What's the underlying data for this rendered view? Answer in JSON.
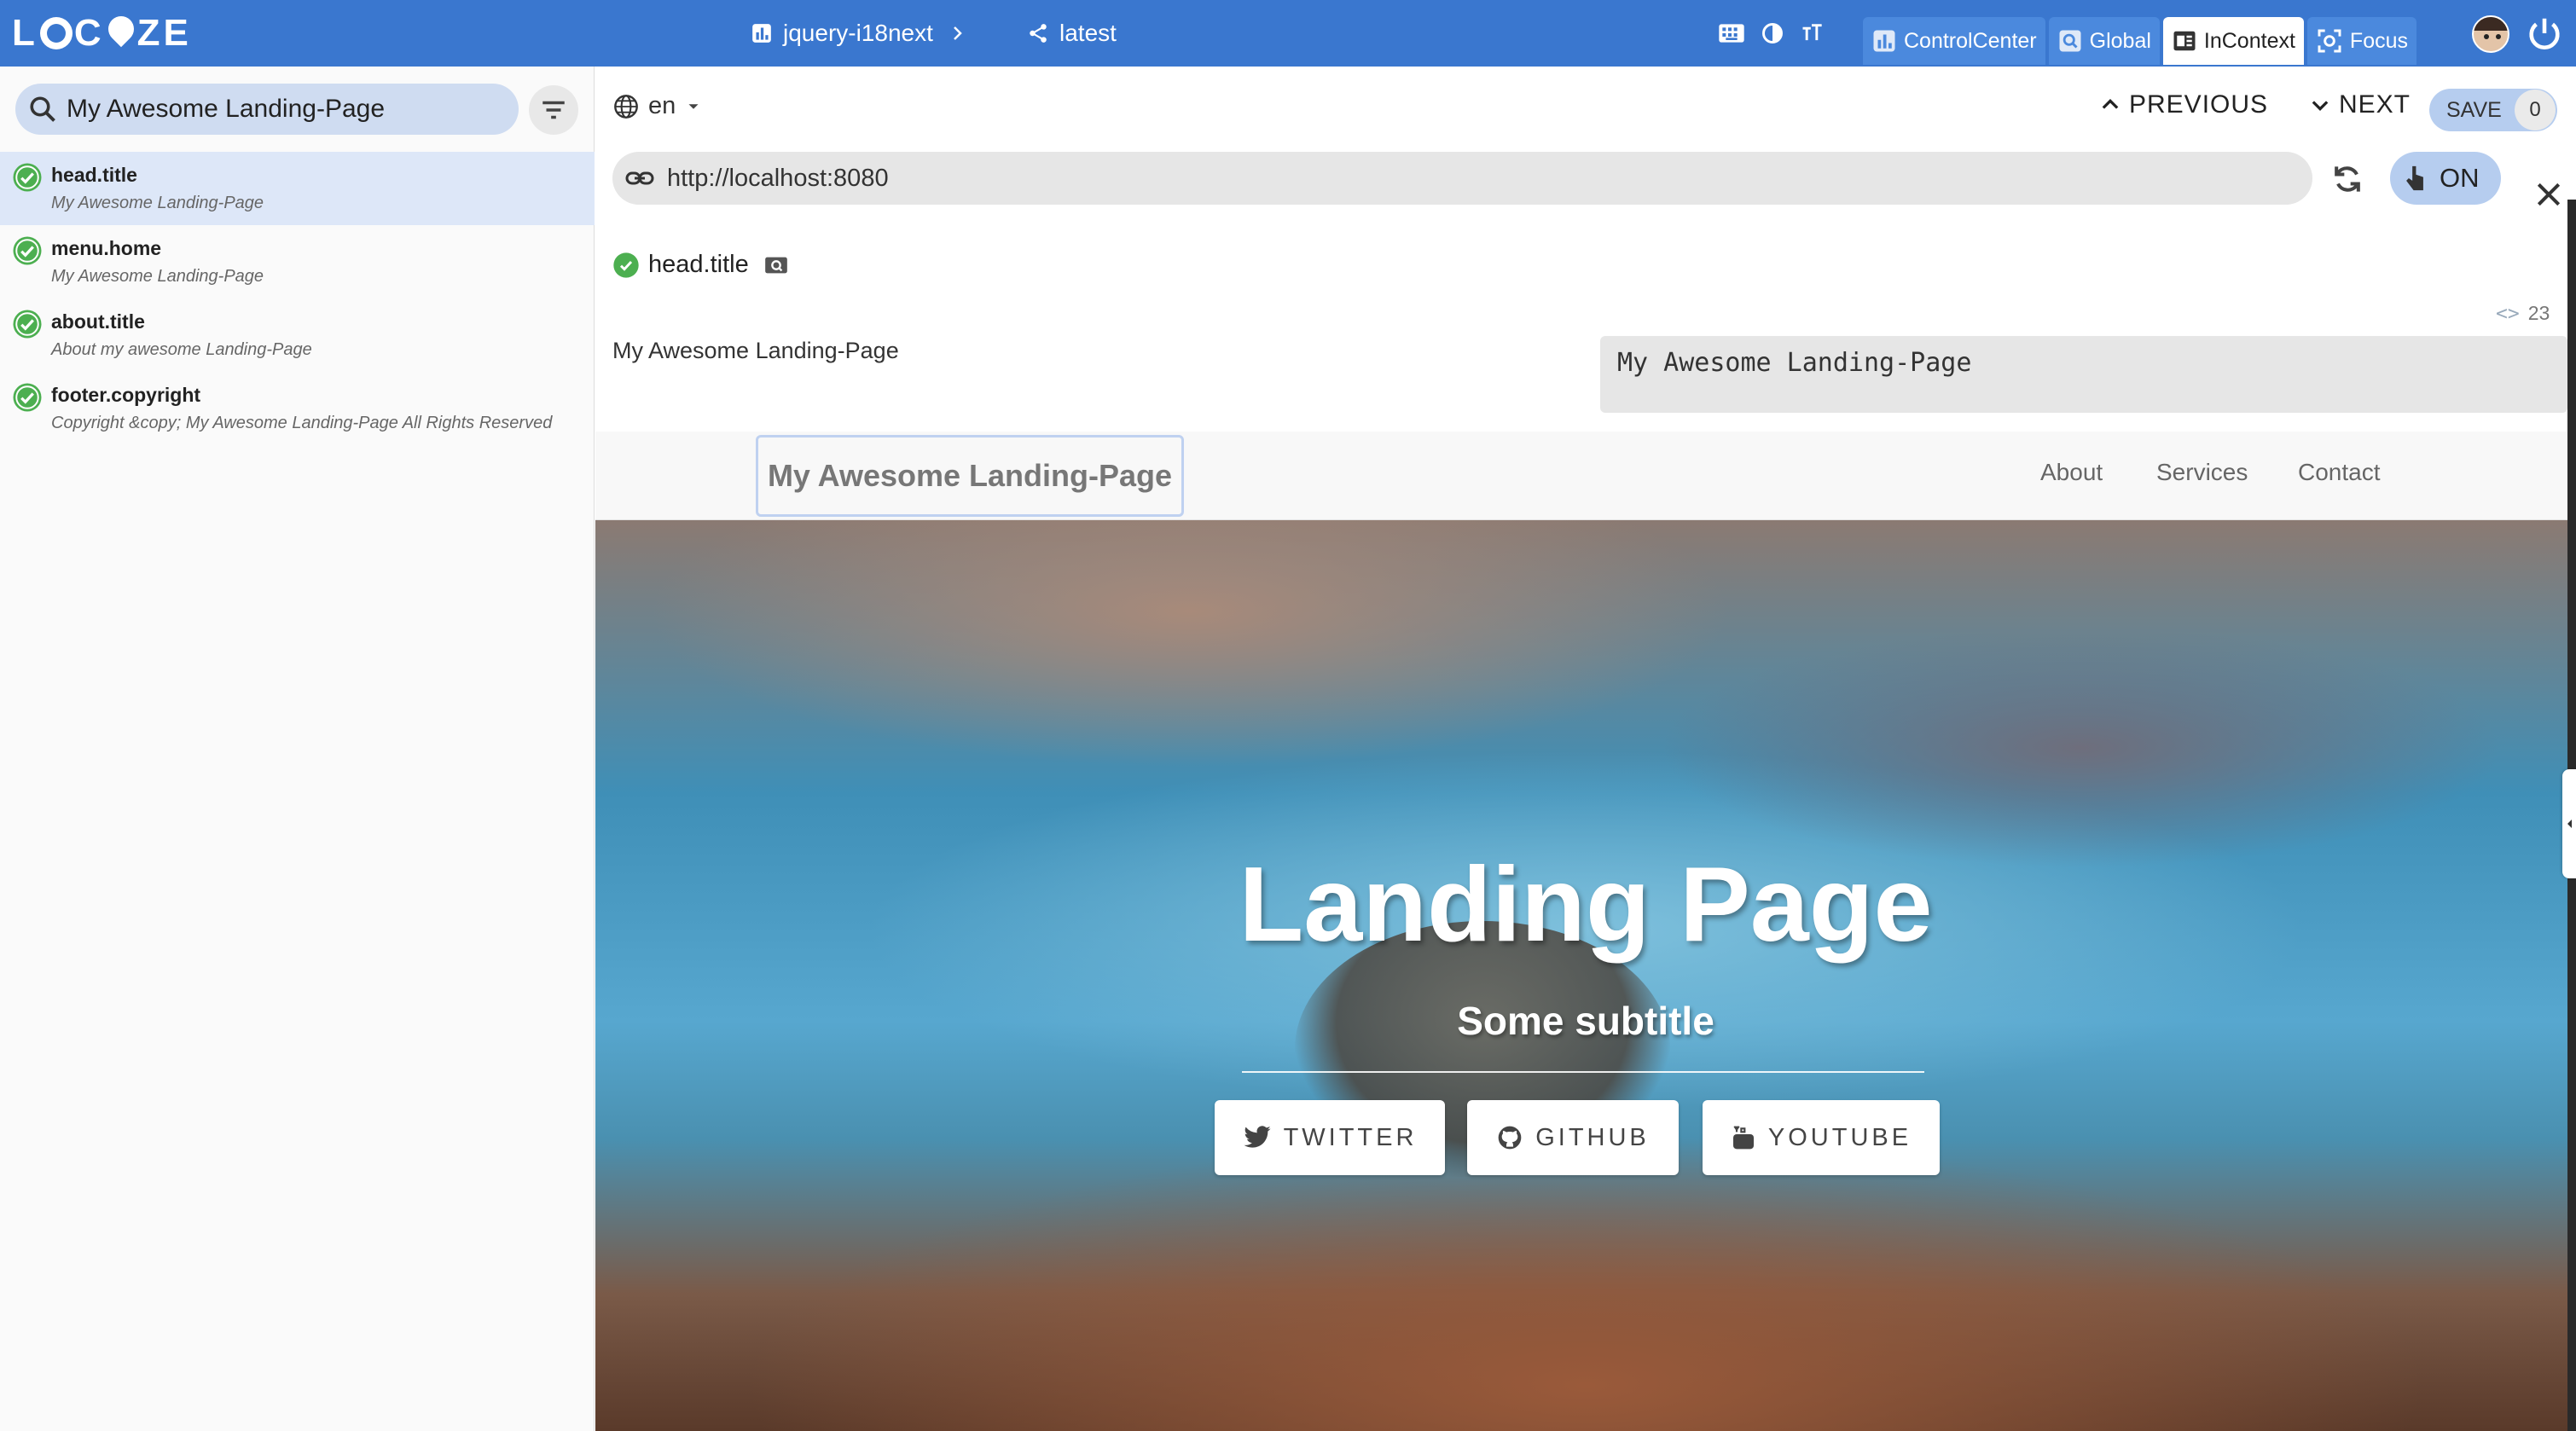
{
  "brand": {
    "logo_text_left": "L",
    "logo_text_right": "ZE"
  },
  "topbar": {
    "project": "jquery-i18next",
    "version": "latest",
    "modes": [
      {
        "label": "ControlCenter",
        "active": false
      },
      {
        "label": "Global",
        "active": false
      },
      {
        "label": "InContext",
        "active": true
      },
      {
        "label": "Focus",
        "active": false
      }
    ]
  },
  "sidebar": {
    "search_value": "My Awesome Landing-Page",
    "items": [
      {
        "key": "head.title",
        "value": "My Awesome Landing-Page",
        "selected": true
      },
      {
        "key": "menu.home",
        "value": "My Awesome Landing-Page",
        "selected": false
      },
      {
        "key": "about.title",
        "value": "About my awesome Landing-Page",
        "selected": false
      },
      {
        "key": "footer.copyright",
        "value": "Copyright &copy; My Awesome Landing-Page All Rights Reserved",
        "selected": false
      }
    ]
  },
  "toolbar": {
    "language": "en",
    "previous_label": "PREVIOUS",
    "next_label": "NEXT",
    "save_label": "SAVE",
    "save_count": "0",
    "url": "http://localhost:8080",
    "toggle_label": "ON"
  },
  "editor": {
    "key": "head.title",
    "char_count": "23",
    "source_text": "My Awesome Landing-Page",
    "translation": "My Awesome Landing-Page"
  },
  "preview": {
    "brand": "My Awesome Landing-Page",
    "nav_links": [
      "About",
      "Services",
      "Contact"
    ],
    "hero_title": "Landing Page",
    "hero_subtitle": "Some subtitle",
    "buttons": [
      "TWITTER",
      "GITHUB",
      "YOUTUBE"
    ]
  },
  "colors": {
    "topbar": "#3a77cf",
    "selected_row": "#dde7f8",
    "check_green": "#4caf50",
    "pill_blue": "#b6cdef"
  }
}
